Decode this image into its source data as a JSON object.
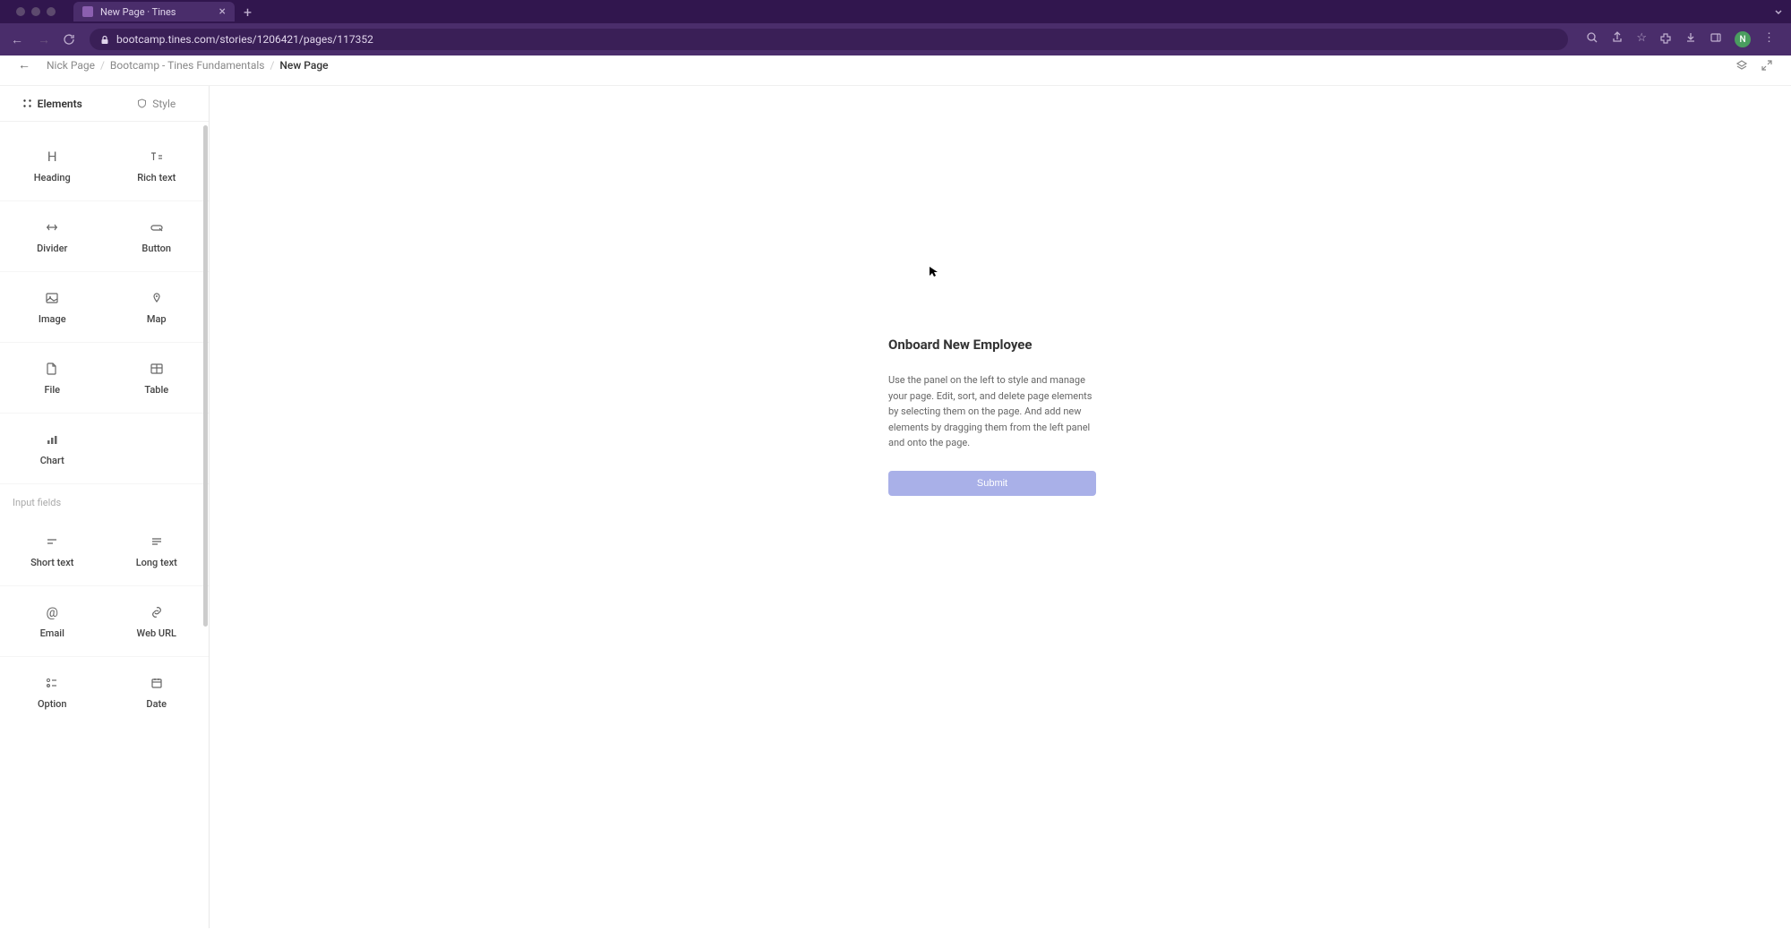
{
  "browser": {
    "tab_title": "New Page · Tines",
    "url": "bootcamp.tines.com/stories/1206421/pages/117352",
    "avatar_initial": "N"
  },
  "header": {
    "breadcrumbs": [
      "Nick Page",
      "Bootcamp - Tines Fundamentals",
      "New Page"
    ]
  },
  "sidebar": {
    "tabs": {
      "elements": "Elements",
      "style": "Style"
    },
    "section_input_fields": "Input fields",
    "elements": {
      "heading": "Heading",
      "rich_text": "Rich text",
      "divider": "Divider",
      "button": "Button",
      "image": "Image",
      "map": "Map",
      "file": "File",
      "table": "Table",
      "chart": "Chart",
      "short_text": "Short text",
      "long_text": "Long text",
      "email": "Email",
      "web_url": "Web URL",
      "option": "Option",
      "date": "Date"
    }
  },
  "page": {
    "heading": "Onboard New Employee",
    "description": "Use the panel on the left to style and manage your page. Edit, sort, and delete page elements by selecting them on the page. And add new elements by dragging them from the left panel and onto the page.",
    "submit_label": "Submit"
  }
}
